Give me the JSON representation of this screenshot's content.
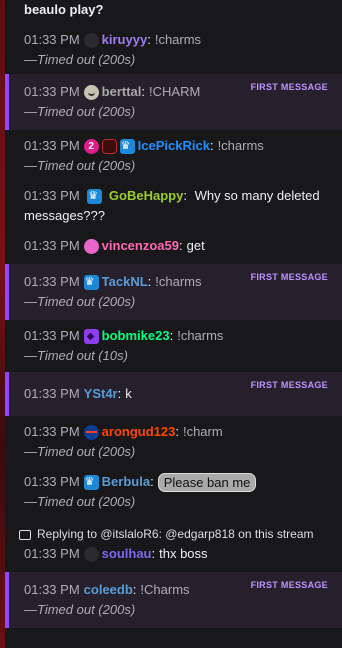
{
  "first_message_label": "FIRST MESSAGE",
  "timeout_prefix": "—",
  "messages": [
    {
      "top_text": "beaulo play?"
    },
    {
      "time": "01:33 PM",
      "user": "kiruyyy",
      "color": "#9b7ff0",
      "badges": [
        "emote-icon"
      ],
      "text": "!charms",
      "timeout": "Timed out (200s)"
    },
    {
      "time": "01:33 PM",
      "user": "berttal",
      "color": "#a9a9a9",
      "badges": [
        "face-icon"
      ],
      "text": "!CHARM",
      "timeout": "Timed out (200s)",
      "first": true
    },
    {
      "time": "01:33 PM",
      "user": "IcePickRick",
      "color": "#1e90ff",
      "badges": [
        "two-icon",
        "hex-icon",
        "crown-icon"
      ],
      "text": "!charms",
      "timeout": "Timed out (200s)"
    },
    {
      "time": "01:33 PM",
      "user": "GoBeHappy",
      "color": "#9acd32",
      "badges": [
        "crown-icon"
      ],
      "text": "Why so many deleted messages???"
    },
    {
      "time": "01:33 PM",
      "user": "vincenzoa59",
      "color": "#ff69b4",
      "badges": [
        "pink-icon"
      ],
      "text": "get"
    },
    {
      "time": "01:33 PM",
      "user": "TackNL",
      "color": "#5b9bd5",
      "badges": [
        "crown-icon"
      ],
      "text": "!charms",
      "timeout": "Timed out (200s)",
      "first": true
    },
    {
      "time": "01:33 PM",
      "user": "bobmike23",
      "color": "#00ff7f",
      "badges": [
        "diamond-icon"
      ],
      "text": "!charms",
      "timeout": "Timed out (10s)"
    },
    {
      "time": "01:33 PM",
      "user": "YSt4r",
      "color": "#5b9bd5",
      "badges": [],
      "text": "k",
      "first": true
    },
    {
      "time": "01:33 PM",
      "user": "arongud123",
      "color": "#ff4500",
      "badges": [
        "nasa-icon"
      ],
      "text": "!charm",
      "timeout": "Timed out (200s)"
    },
    {
      "time": "01:33 PM",
      "user": "Berbula",
      "color": "#5b9bd5",
      "badges": [
        "crown-icon"
      ],
      "emote": "Please ban me",
      "timeout": "Timed out (200s)"
    },
    {
      "reply": "Replying to @itslaloR6: @edgarp818 on this stream",
      "time": "01:33 PM",
      "user": "soulhau",
      "color": "#7b68ee",
      "badges": [
        "emote-icon"
      ],
      "text": "thx boss"
    },
    {
      "time": "01:33 PM",
      "user": "coleedb",
      "color": "#5b9bd5",
      "badges": [],
      "text": "!Charms",
      "timeout": "Timed out (200s)",
      "first": true
    }
  ]
}
